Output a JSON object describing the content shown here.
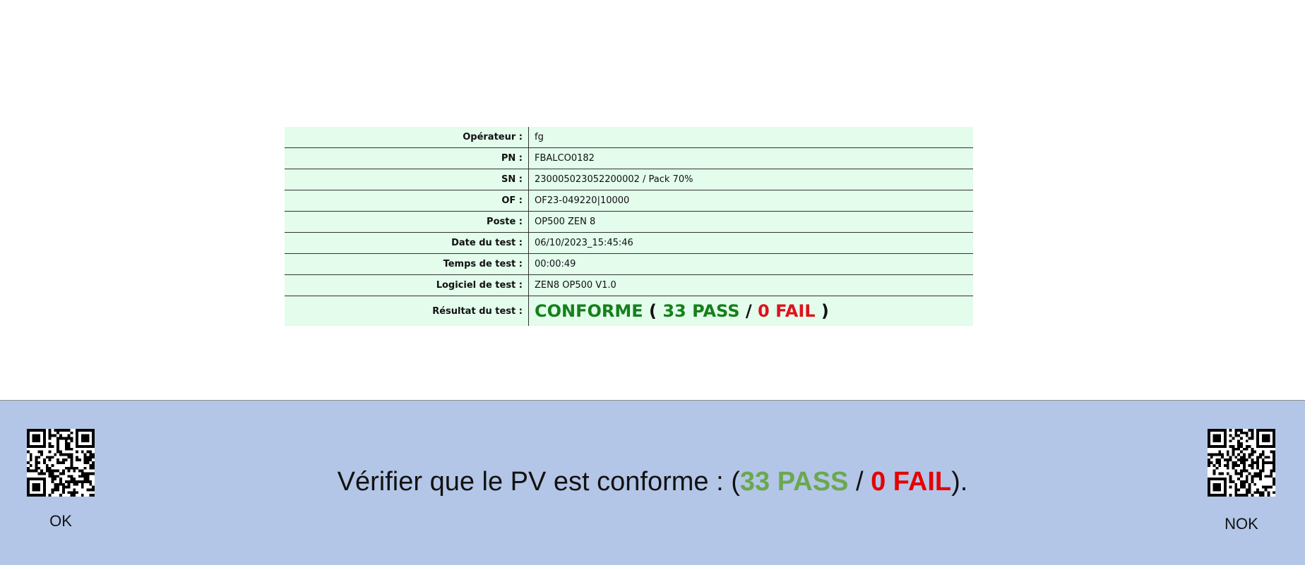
{
  "report": {
    "rows": [
      {
        "label": "Opérateur :",
        "value": "fg"
      },
      {
        "label": "PN :",
        "value": "FBALCO0182"
      },
      {
        "label": "SN :",
        "value": "230005023052200002 / Pack 70%"
      },
      {
        "label": "OF :",
        "value": "OF23-049220|10000"
      },
      {
        "label": "Poste :",
        "value": "OP500 ZEN 8"
      },
      {
        "label": "Date du test :",
        "value": "06/10/2023_15:45:46"
      },
      {
        "label": "Temps de test :",
        "value": "00:00:49"
      },
      {
        "label": "Logiciel de test :",
        "value": "ZEN8 OP500 V1.0"
      }
    ],
    "result": {
      "label": "Résultat du test :",
      "status": "CONFORME",
      "open": "(",
      "pass": "33 PASS",
      "sep": "/",
      "fail": "0 FAIL",
      "close": ")"
    }
  },
  "panel": {
    "message_prefix": "Vérifier que le PV est conforme : (",
    "message_pass": "33 PASS",
    "message_sep": " / ",
    "message_fail": "0 FAIL",
    "message_suffix": ").",
    "ok_label": "OK",
    "nok_label": "NOK"
  },
  "colors": {
    "row_bg": "#e3fcec",
    "pass_green": "#16801a",
    "fail_red": "#e0111b",
    "panel_bg": "#b3c6e7"
  },
  "icons": {
    "ok_qr": "qr-code-icon",
    "nok_qr": "qr-code-icon"
  }
}
